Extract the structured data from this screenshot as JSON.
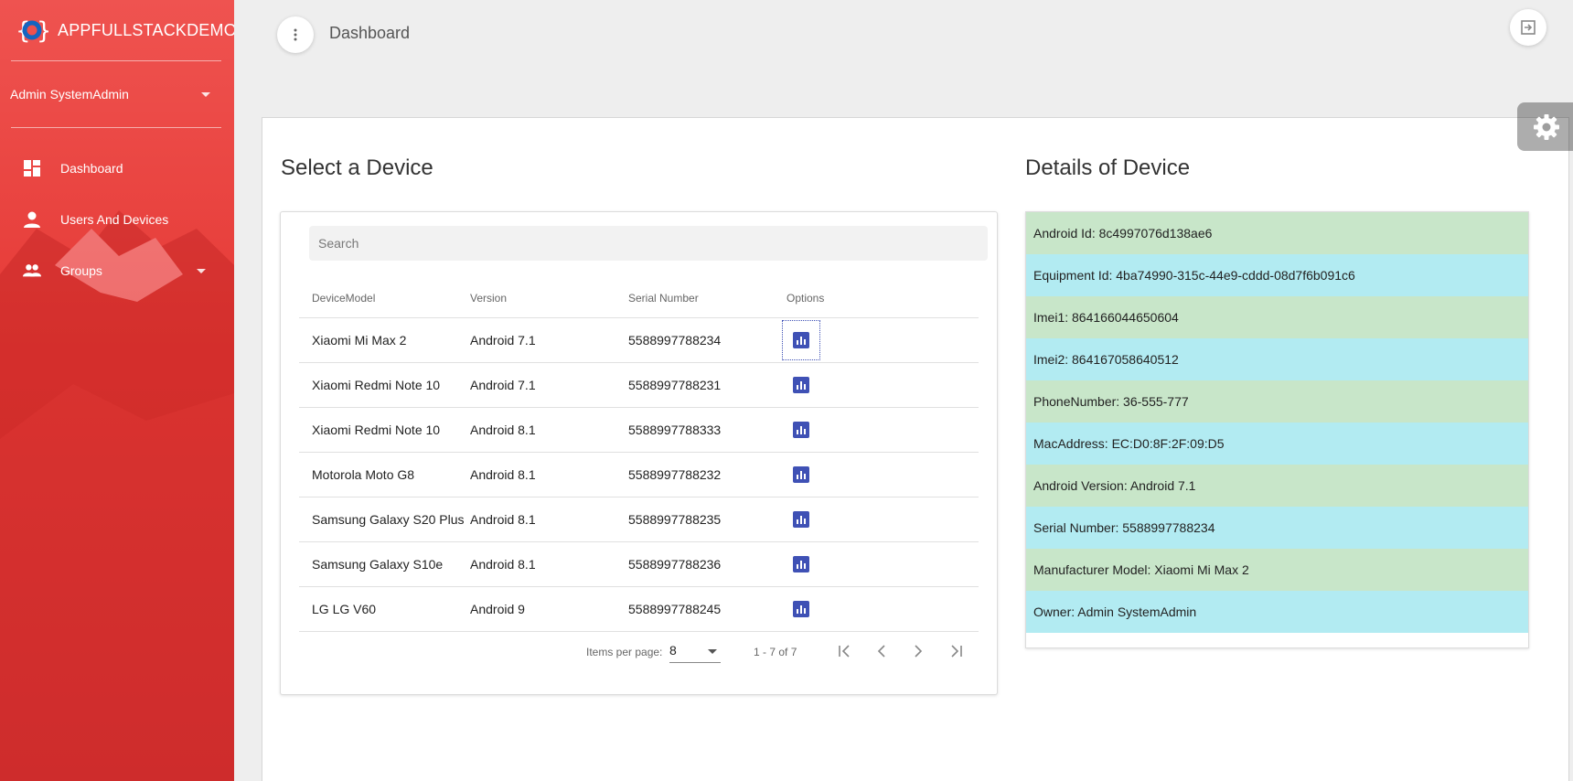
{
  "brand": {
    "name": "APPFULLSTACKDEMO"
  },
  "user": {
    "name": "Admin SystemAdmin"
  },
  "sidebar": {
    "items": [
      {
        "label": "Dashboard",
        "icon": "dashboard-icon"
      },
      {
        "label": "Users And Devices",
        "icon": "person-icon"
      },
      {
        "label": "Groups",
        "icon": "group-icon"
      }
    ]
  },
  "header": {
    "title": "Dashboard"
  },
  "devices": {
    "title": "Select a Device",
    "search_placeholder": "Search",
    "columns": [
      "DeviceModel",
      "Version",
      "Serial Number",
      "Options"
    ],
    "rows": [
      {
        "model": "Xiaomi Mi Max 2",
        "version": "Android 7.1",
        "serial": "5588997788234"
      },
      {
        "model": "Xiaomi Redmi Note 10",
        "version": "Android 7.1",
        "serial": "5588997788231"
      },
      {
        "model": "Xiaomi Redmi Note 10",
        "version": "Android 8.1",
        "serial": "5588997788333"
      },
      {
        "model": "Motorola Moto G8",
        "version": "Android 8.1",
        "serial": "5588997788232"
      },
      {
        "model": "Samsung Galaxy S20 Plus",
        "version": "Android 8.1",
        "serial": "5588997788235"
      },
      {
        "model": "Samsung Galaxy S10e",
        "version": "Android 8.1",
        "serial": "5588997788236"
      },
      {
        "model": "LG LG V60",
        "version": "Android 9",
        "serial": "5588997788245"
      }
    ],
    "paginator": {
      "label": "Items per page:",
      "page_size": "8",
      "range": "1 - 7 of 7"
    }
  },
  "details": {
    "title": "Details of Device",
    "items": [
      "Android Id: 8c4997076d138ae6",
      "Equipment Id: 4ba74990-315c-44e9-cddd-08d7f6b091c6",
      "Imei1: 864166044650604",
      "Imei2: 864167058640512",
      "PhoneNumber: 36-555-777",
      "MacAddress: EC:D0:8F:2F:09:D5",
      "Android Version: Android 7.1",
      "Serial Number: 5588997788234",
      "Manufacturer Model: Xiaomi Mi Max 2",
      "Owner: Admin SystemAdmin"
    ]
  },
  "colors": {
    "sidebar": "#e53935",
    "accent": "#3f51b5",
    "row_green": "#c8e6c9",
    "row_blue": "#b2ebf2"
  }
}
